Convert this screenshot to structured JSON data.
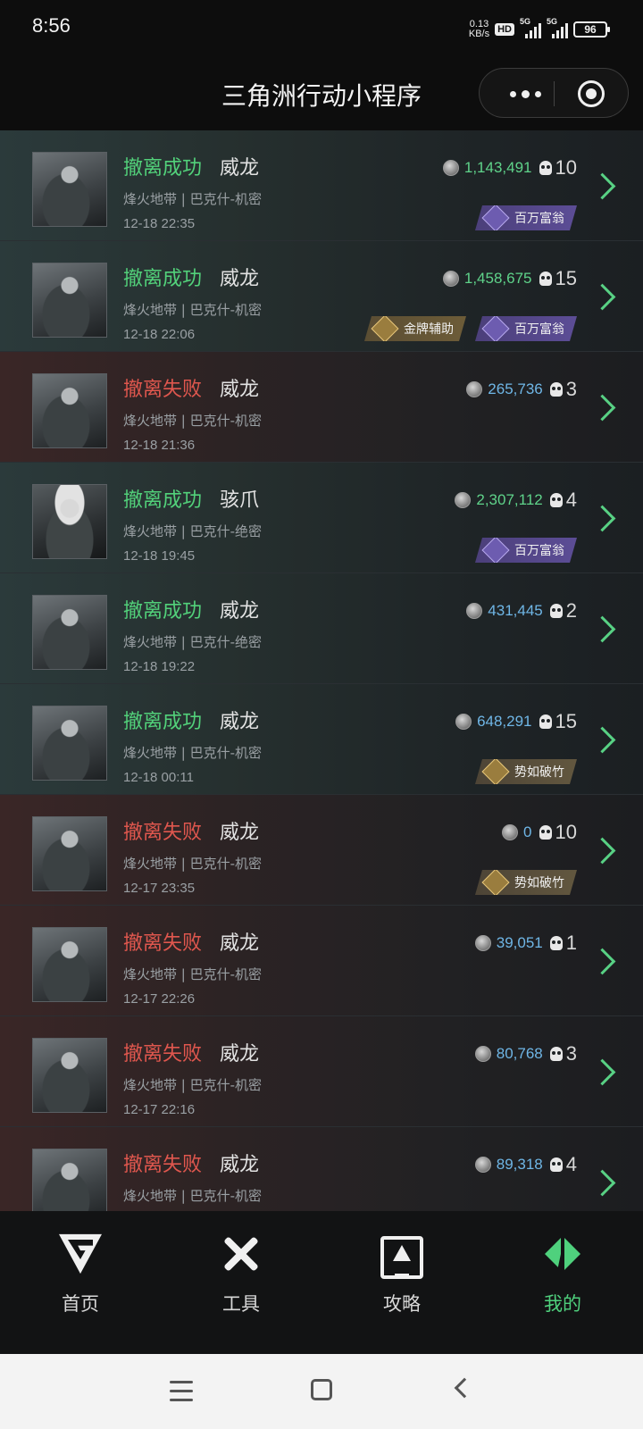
{
  "status_bar": {
    "time": "8:56",
    "net_speed_value": "0.13",
    "net_speed_unit": "KB/s",
    "hd_badge": "HD",
    "signal_1_label": "5G",
    "signal_2_label": "5G",
    "battery": "96"
  },
  "header": {
    "title": "三角洲行动小程序",
    "more_icon": "more-dots-icon",
    "close_icon": "close-target-icon"
  },
  "records": [
    {
      "result": "撤离成功",
      "result_type": "success",
      "operator": "威龙",
      "map": "烽火地带 | 巴克什-机密",
      "time": "12-18 22:35",
      "value": "1,143,491",
      "value_color": "green",
      "kills": "10",
      "badges": [
        {
          "label": "百万富翁",
          "style": "purple"
        }
      ]
    },
    {
      "result": "撤离成功",
      "result_type": "success",
      "operator": "威龙",
      "map": "烽火地带 | 巴克什-机密",
      "time": "12-18 22:06",
      "value": "1,458,675",
      "value_color": "green",
      "kills": "15",
      "badges": [
        {
          "label": "金牌辅助",
          "style": "gold"
        },
        {
          "label": "百万富翁",
          "style": "purple"
        }
      ]
    },
    {
      "result": "撤离失败",
      "result_type": "fail",
      "operator": "威龙",
      "map": "烽火地带 | 巴克什-机密",
      "time": "12-18 21:36",
      "value": "265,736",
      "value_color": "blue",
      "kills": "3",
      "badges": []
    },
    {
      "result": "撤离成功",
      "result_type": "success",
      "operator": "骇爪",
      "map": "烽火地带 | 巴克什-绝密",
      "time": "12-18 19:45",
      "value": "2,307,112",
      "value_color": "green",
      "kills": "4",
      "badges": [
        {
          "label": "百万富翁",
          "style": "purple"
        }
      ]
    },
    {
      "result": "撤离成功",
      "result_type": "success",
      "operator": "威龙",
      "map": "烽火地带 | 巴克什-绝密",
      "time": "12-18 19:22",
      "value": "431,445",
      "value_color": "blue",
      "kills": "2",
      "badges": []
    },
    {
      "result": "撤离成功",
      "result_type": "success",
      "operator": "威龙",
      "map": "烽火地带 | 巴克什-机密",
      "time": "12-18 00:11",
      "value": "648,291",
      "value_color": "blue",
      "kills": "15",
      "badges": [
        {
          "label": "势如破竹",
          "style": "goldlight"
        }
      ]
    },
    {
      "result": "撤离失败",
      "result_type": "fail",
      "operator": "威龙",
      "map": "烽火地带 | 巴克什-机密",
      "time": "12-17 23:35",
      "value": "0",
      "value_color": "blue",
      "kills": "10",
      "badges": [
        {
          "label": "势如破竹",
          "style": "goldlight"
        }
      ]
    },
    {
      "result": "撤离失败",
      "result_type": "fail",
      "operator": "威龙",
      "map": "烽火地带 | 巴克什-机密",
      "time": "12-17 22:26",
      "value": "39,051",
      "value_color": "blue",
      "kills": "1",
      "badges": []
    },
    {
      "result": "撤离失败",
      "result_type": "fail",
      "operator": "威龙",
      "map": "烽火地带 | 巴克什-机密",
      "time": "12-17 22:16",
      "value": "80,768",
      "value_color": "blue",
      "kills": "3",
      "badges": []
    },
    {
      "result": "撤离失败",
      "result_type": "fail",
      "operator": "威龙",
      "map": "烽火地带 | 巴克什-机密",
      "time": "",
      "value": "89,318",
      "value_color": "blue",
      "kills": "4",
      "badges": []
    }
  ],
  "tabbar": {
    "items": [
      {
        "label": "首页",
        "icon": "home-logo-icon",
        "active": false
      },
      {
        "label": "工具",
        "icon": "tools-icon",
        "active": false
      },
      {
        "label": "攻略",
        "icon": "guide-monitor-icon",
        "active": false
      },
      {
        "label": "我的",
        "icon": "profile-logo-icon",
        "active": true
      }
    ]
  },
  "colors": {
    "success": "#52d17a",
    "fail": "#e0574e",
    "value_blue": "#6fb6e6",
    "accent_green": "#4fd17d"
  }
}
